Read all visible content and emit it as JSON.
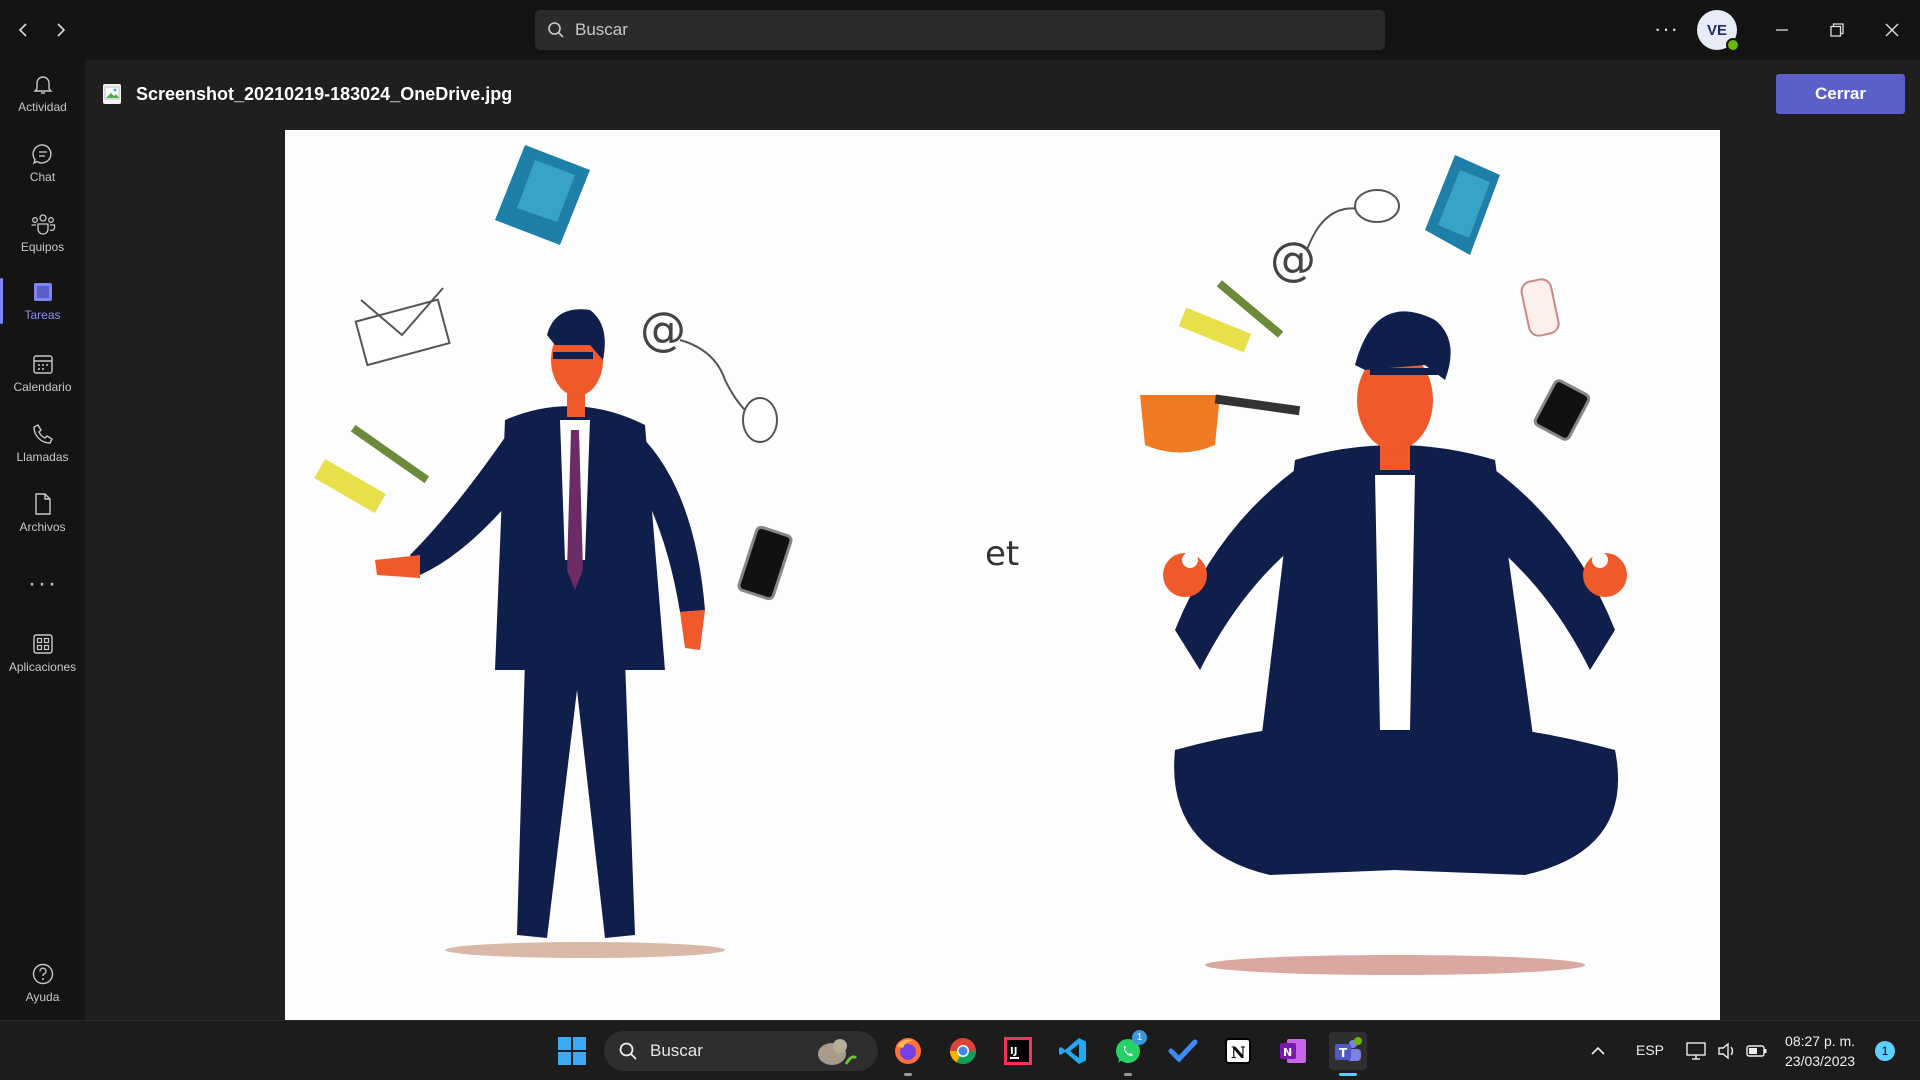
{
  "titlebar": {
    "search_placeholder": "Buscar",
    "avatar_initials": "VE",
    "more_label": "···"
  },
  "rail": {
    "items": [
      {
        "label": "Actividad",
        "icon": "bell-icon"
      },
      {
        "label": "Chat",
        "icon": "chat-icon"
      },
      {
        "label": "Equipos",
        "icon": "teams-icon"
      },
      {
        "label": "Tareas",
        "icon": "tasks-icon",
        "active": true
      },
      {
        "label": "Calendario",
        "icon": "calendar-icon"
      },
      {
        "label": "Llamadas",
        "icon": "phone-icon"
      },
      {
        "label": "Archivos",
        "icon": "file-icon"
      },
      {
        "label": "Aplicaciones",
        "icon": "apps-icon"
      },
      {
        "label": "Ayuda",
        "icon": "help-icon"
      }
    ],
    "more_label": "···"
  },
  "viewer": {
    "file_name": "Screenshot_20210219-183024_OneDrive.jpg",
    "close_label": "Cerrar",
    "image_caption": "et"
  },
  "taskbar": {
    "search_label": "Buscar",
    "whatsapp_badge": "1",
    "language": "ESP",
    "time": "08:27 p. m.",
    "date": "23/03/2023",
    "notification_count": "1"
  },
  "colors": {
    "accent": "#5b5fc7",
    "active_rail": "#8b8cf5",
    "presence": "#6bb700"
  }
}
